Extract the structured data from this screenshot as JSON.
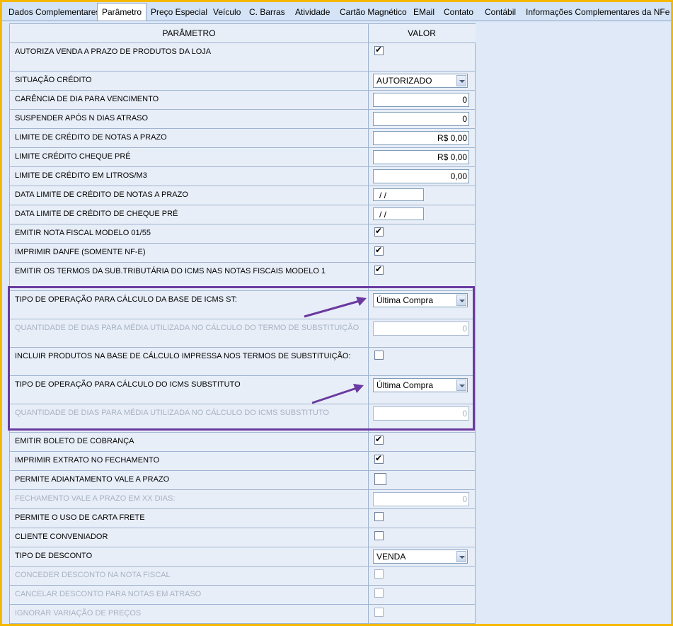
{
  "tabs": [
    {
      "label": "Dados Complementares",
      "active": false
    },
    {
      "label": "Parâmetro",
      "active": true
    },
    {
      "label": "Preço Especial",
      "active": false
    },
    {
      "label": "Veículo",
      "active": false
    },
    {
      "label": "C. Barras",
      "active": false
    },
    {
      "label": "Atividade",
      "active": false
    },
    {
      "label": "Cartão Magnético",
      "active": false
    },
    {
      "label": "EMail",
      "active": false
    },
    {
      "label": "Contato",
      "active": false
    },
    {
      "label": "Contábil",
      "active": false
    },
    {
      "label": "Informações Complementares da NFe",
      "active": false
    }
  ],
  "grid": {
    "col_param": "PARÂMETRO",
    "col_value": "VALOR",
    "rows": [
      {
        "label": "AUTORIZA VENDA A PRAZO DE PRODUTOS DA LOJA",
        "type": "checkbox",
        "checked": true,
        "enabled": true
      },
      {
        "label": "SITUAÇÃO CRÉDITO",
        "type": "select",
        "value": "AUTORIZADO",
        "enabled": true
      },
      {
        "label": "CARÊNCIA DE DIA PARA VENCIMENTO",
        "type": "input",
        "value": "0",
        "enabled": true
      },
      {
        "label": "SUSPENDER APÓS N DIAS ATRASO",
        "type": "input",
        "value": "0",
        "enabled": true
      },
      {
        "label": "LIMITE DE CRÉDITO DE NOTAS A PRAZO",
        "type": "input",
        "value": "R$ 0,00",
        "enabled": true
      },
      {
        "label": "LIMITE CRÉDITO CHEQUE PRÉ",
        "type": "input",
        "value": "R$ 0,00",
        "enabled": true
      },
      {
        "label": "LIMITE DE CRÉDITO EM LITROS/M3",
        "type": "input",
        "value": "0,00",
        "enabled": true
      },
      {
        "label": "DATA LIMITE DE CRÉDITO DE NOTAS A PRAZO",
        "type": "date",
        "value": "/ /",
        "enabled": true
      },
      {
        "label": "DATA LIMITE DE CRÉDITO DE CHEQUE PRÉ",
        "type": "date",
        "value": "/ /",
        "enabled": true
      },
      {
        "label": "EMITIR NOTA FISCAL MODELO 01/55",
        "type": "checkbox",
        "checked": true,
        "enabled": true
      },
      {
        "label": "IMPRIMIR DANFE (SOMENTE NF-E)",
        "type": "checkbox",
        "checked": true,
        "enabled": true
      },
      {
        "label": "EMITIR OS TERMOS DA SUB.TRIBUTÁRIA DO ICMS NAS NOTAS FISCAIS MODELO 1",
        "type": "checkbox",
        "checked": true,
        "enabled": true
      },
      {
        "label": "TIPO DE OPERAÇÃO PARA CÁLCULO DA BASE DE ICMS ST:",
        "type": "select",
        "value": "Última Compra",
        "enabled": true
      },
      {
        "label": "QUANTIDADE DE DIAS PARA MÉDIA UTILIZADA NO CÁLCULO DO TERMO DE SUBSTITUIÇÃO",
        "type": "input",
        "value": "0",
        "enabled": false
      },
      {
        "label": "INCLUIR PRODUTOS NA BASE DE CÁLCULO IMPRESSA NOS TERMOS DE SUBSTITUIÇÃO:",
        "type": "checkbox",
        "checked": false,
        "enabled": true
      },
      {
        "label": "TIPO DE OPERAÇÃO PARA CÁLCULO DO ICMS SUBSTITUTO",
        "type": "select",
        "value": "Última Compra",
        "enabled": true
      },
      {
        "label": "QUANTIDADE DE DIAS PARA MÉDIA UTILIZADA NO CÁLCULO DO ICMS SUBSTITUTO",
        "type": "input",
        "value": "0",
        "enabled": false
      },
      {
        "label": "EMITIR BOLETO DE COBRANÇA",
        "type": "checkbox",
        "checked": true,
        "enabled": true
      },
      {
        "label": "IMPRIMIR EXTRATO NO FECHAMENTO",
        "type": "checkbox",
        "checked": true,
        "enabled": true
      },
      {
        "label": "PERMITE ADIANTAMENTO VALE A PRAZO",
        "type": "checkbox",
        "checked": false,
        "enabled": true,
        "focused": true
      },
      {
        "label": "FECHAMENTO VALE A PRAZO EM XX DIAS:",
        "type": "input",
        "value": "0",
        "enabled": false
      },
      {
        "label": "PERMITE O USO DE CARTA FRETE",
        "type": "checkbox",
        "checked": false,
        "enabled": true
      },
      {
        "label": "CLIENTE CONVENIADOR",
        "type": "checkbox",
        "checked": false,
        "enabled": true
      },
      {
        "label": "TIPO DE DESCONTO",
        "type": "select",
        "value": "VENDA",
        "enabled": true
      },
      {
        "label": "CONCEDER DESCONTO NA NOTA FISCAL",
        "type": "checkbox",
        "checked": false,
        "enabled": false
      },
      {
        "label": "CANCELAR DESCONTO PARA NOTAS EM ATRASO",
        "type": "checkbox",
        "checked": false,
        "enabled": false
      },
      {
        "label": "IGNORAR VARIAÇÃO DE PREÇOS",
        "type": "checkbox",
        "checked": false,
        "enabled": false
      }
    ]
  },
  "colors": {
    "highlight": "#6a3aa0",
    "frame": "#f5b800"
  }
}
